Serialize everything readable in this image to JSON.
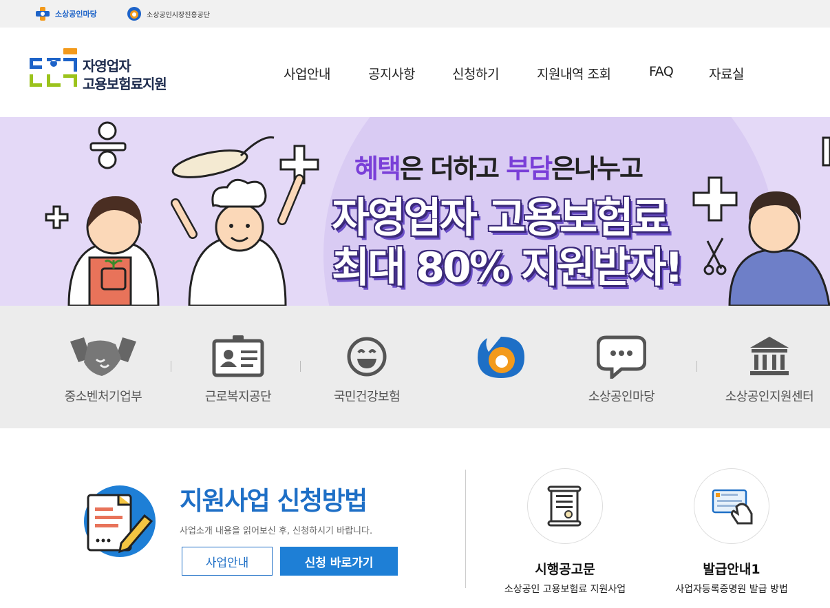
{
  "topbar": {
    "link1_label": "소상공인마당",
    "link2_label": "소상공인시장진흥공단"
  },
  "header": {
    "logo_line1": "자영업자",
    "logo_line2": "고용보험료지원",
    "nav": [
      "사업안내",
      "공지사항",
      "신청하기",
      "지원내역 조회",
      "FAQ",
      "자료실"
    ]
  },
  "banner": {
    "sub_hl1": "혜택",
    "sub_t1": "은 더하고 ",
    "sub_hl2": "부담",
    "sub_t2": "은나누고",
    "main_line1": "자영업자 고용보험료",
    "main_line2": "최대 80% 지원받자!"
  },
  "sites": [
    {
      "label": "중소벤처기업부",
      "icon": "handshake-icon"
    },
    {
      "label": "근로복지공단",
      "icon": "id-card-icon"
    },
    {
      "label": "국민건강보험",
      "icon": "smile-icon"
    },
    {
      "label": "",
      "icon": "semas-logo-icon"
    },
    {
      "label": "소상공인마당",
      "icon": "speech-bubble-icon"
    },
    {
      "label": "소상공인지원센터",
      "icon": "government-building-icon"
    }
  ],
  "guide": {
    "title": "지원사업 신청방법",
    "desc": "사업소개 내용을 읽어보신 후, 신청하시기 바랍니다.",
    "btn_info": "사업안내",
    "btn_apply": "신청 바로가기"
  },
  "cards": [
    {
      "title": "시행공고문",
      "subtitle": "소상공인 고용보험료 지원사업",
      "icon": "document-certificate-icon"
    },
    {
      "title": "발급안내1",
      "subtitle": "사업자등록증명원 발급 방법",
      "icon": "card-in-hand-icon"
    }
  ],
  "colors": {
    "accent_blue": "#1e7fd6",
    "banner_bg": "#e4d9f7",
    "banner_highlight": "#7a3fd8",
    "logo_green": "#9bc31c",
    "logo_blue": "#1d63c8"
  }
}
